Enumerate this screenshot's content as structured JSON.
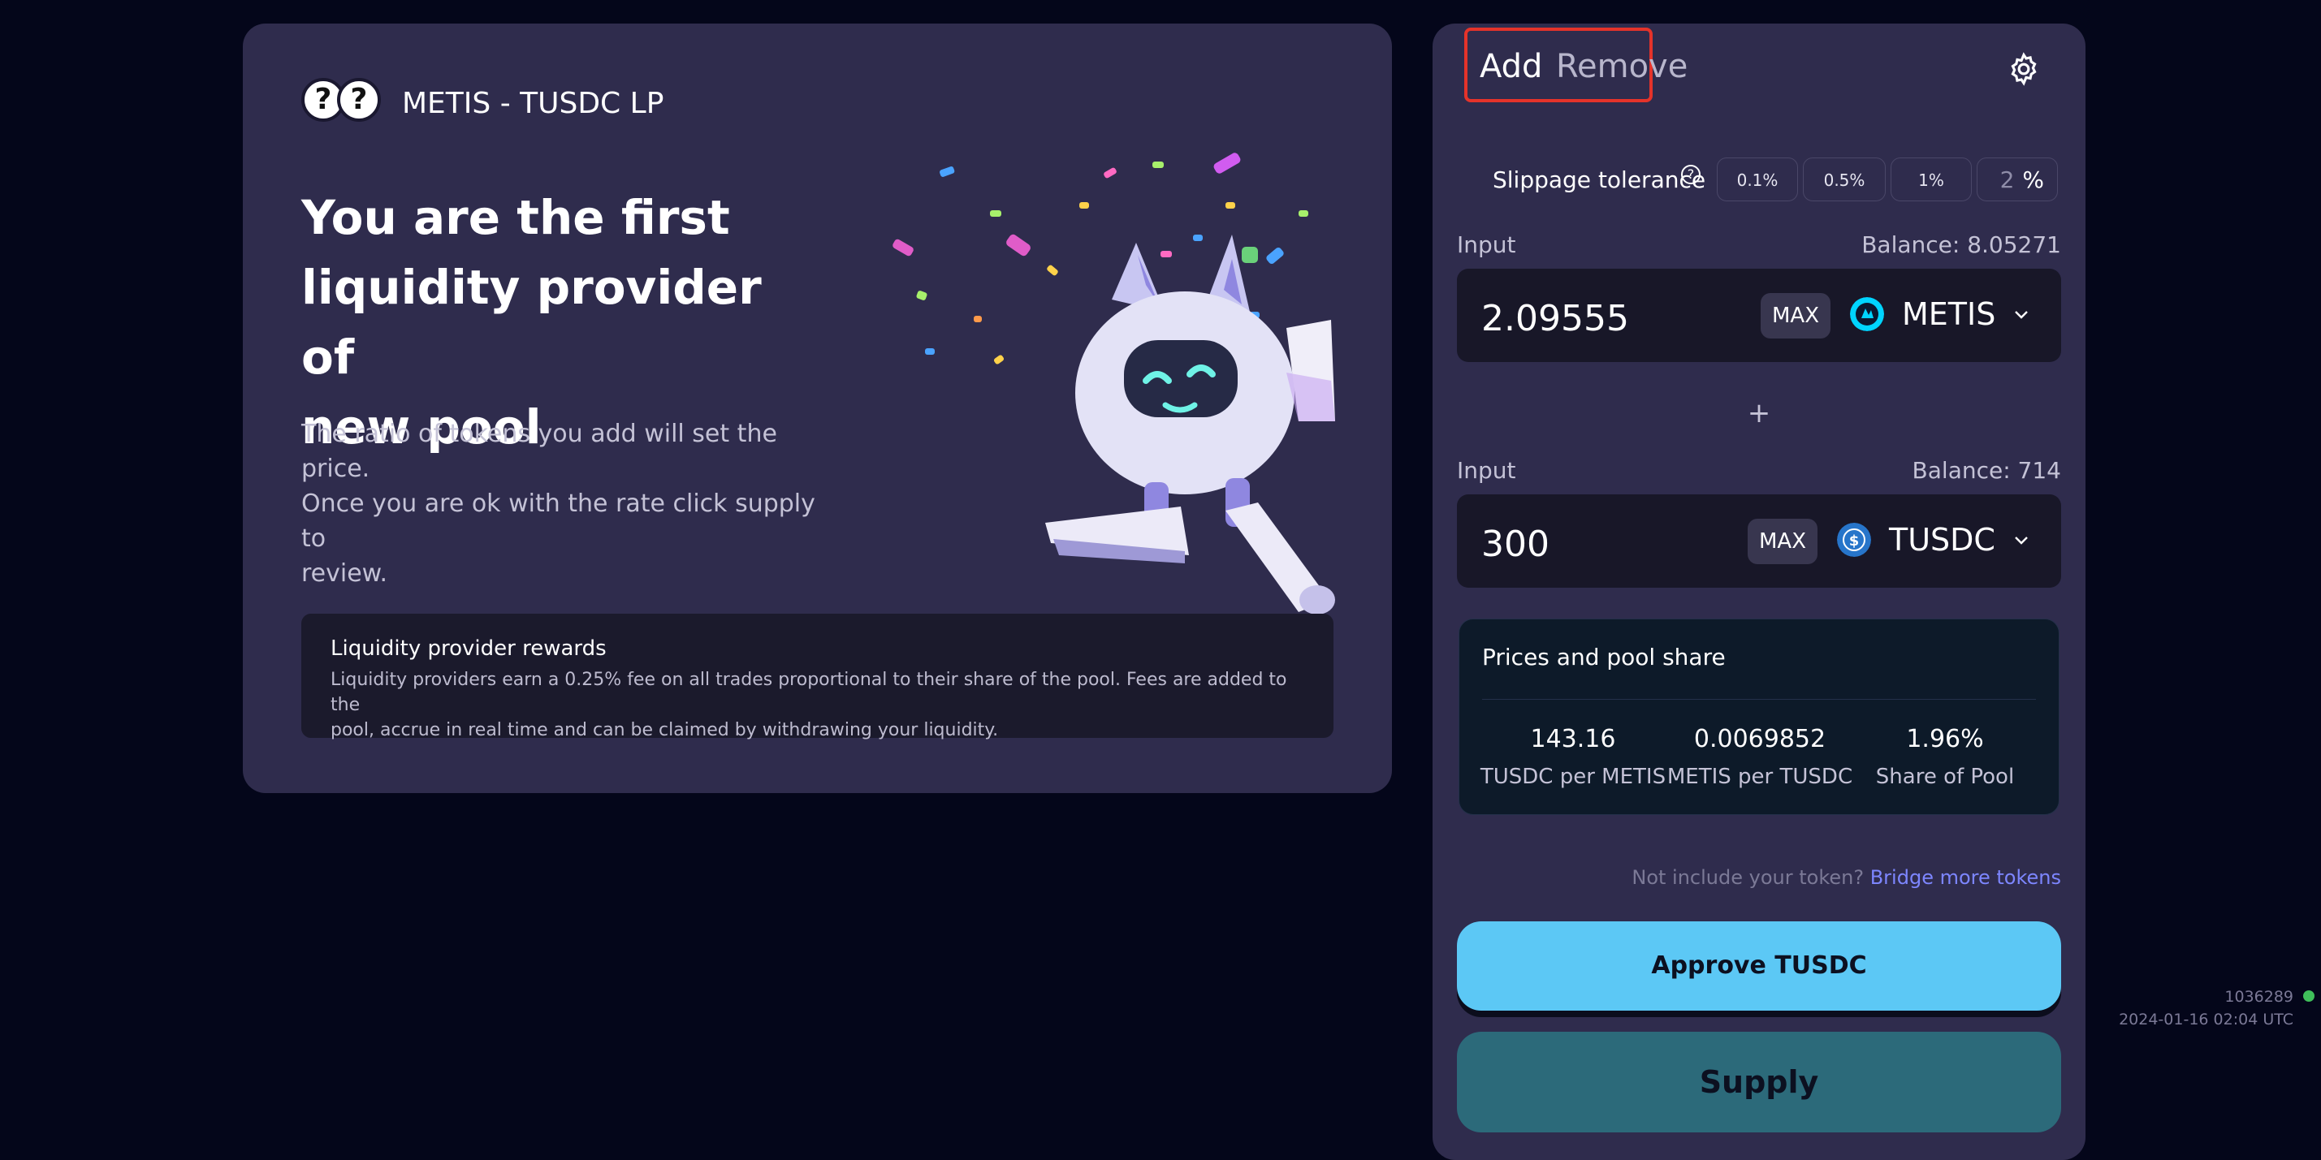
{
  "left_panel": {
    "pair_name": "METIS - TUSDC LP",
    "token_a_icon": "?",
    "token_b_icon": "?",
    "hero_line1": "You are the first",
    "hero_line2": "liquidity provider of",
    "hero_line3": "new pool",
    "desc_line1": "The ratio of tokens you add will set the price.",
    "desc_line2": "Once you are ok with the rate click supply to",
    "desc_line3": "review.",
    "rewards_title": "Liquidity provider rewards",
    "rewards_line1": "Liquidity providers earn a 0.25% fee on all trades proportional to their share of the pool. Fees are added to the",
    "rewards_line2": "pool, accrue in real time and can be claimed by withdrawing your liquidity.",
    "mascot_icon": "robot-mascot-icon"
  },
  "tabs": {
    "add": "Add",
    "remove": "Remove"
  },
  "slippage": {
    "label": "Slippage tolerance",
    "help": "?",
    "options": [
      "0.1%",
      "0.5%",
      "1%"
    ],
    "custom_value": "2",
    "custom_unit": "%"
  },
  "input1": {
    "label": "Input",
    "balance": "Balance: 8.05271",
    "amount": "2.09555",
    "max": "MAX",
    "token": "METIS",
    "token_color": "#00d4ff"
  },
  "plus": "+",
  "input2": {
    "label": "Input",
    "balance": "Balance: 714",
    "amount": "300",
    "max": "MAX",
    "token": "TUSDC",
    "token_color": "#2775ca"
  },
  "prices": {
    "title": "Prices and pool share",
    "items": [
      {
        "value": "143.16",
        "label": "TUSDC per METIS"
      },
      {
        "value": "0.0069852",
        "label": "METIS per TUSDC"
      },
      {
        "value": "1.96%",
        "label": "Share of Pool"
      }
    ]
  },
  "bridge": {
    "text": "Not include your token?",
    "link": "Bridge more tokens"
  },
  "buttons": {
    "approve": "Approve TUSDC",
    "supply": "Supply"
  },
  "status": {
    "block": "1036289",
    "time": "2024-01-16 02:04 UTC",
    "dot_color": "#3fbf5a"
  }
}
